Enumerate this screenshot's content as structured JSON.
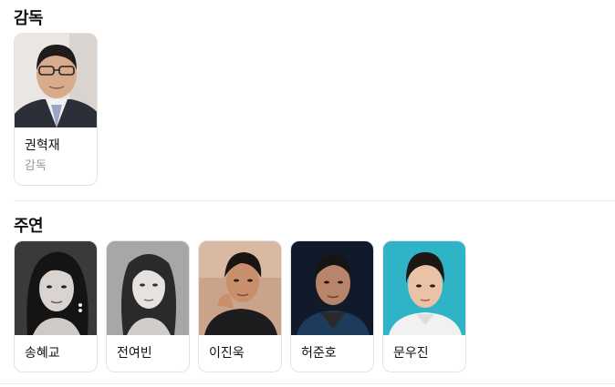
{
  "directors": {
    "title": "감독",
    "people": [
      {
        "name": "권혁재",
        "role": "감독"
      }
    ]
  },
  "cast": {
    "title": "주연",
    "people": [
      {
        "name": "송혜교"
      },
      {
        "name": "전여빈"
      },
      {
        "name": "이진욱"
      },
      {
        "name": "허준호"
      },
      {
        "name": "문우진"
      }
    ]
  }
}
